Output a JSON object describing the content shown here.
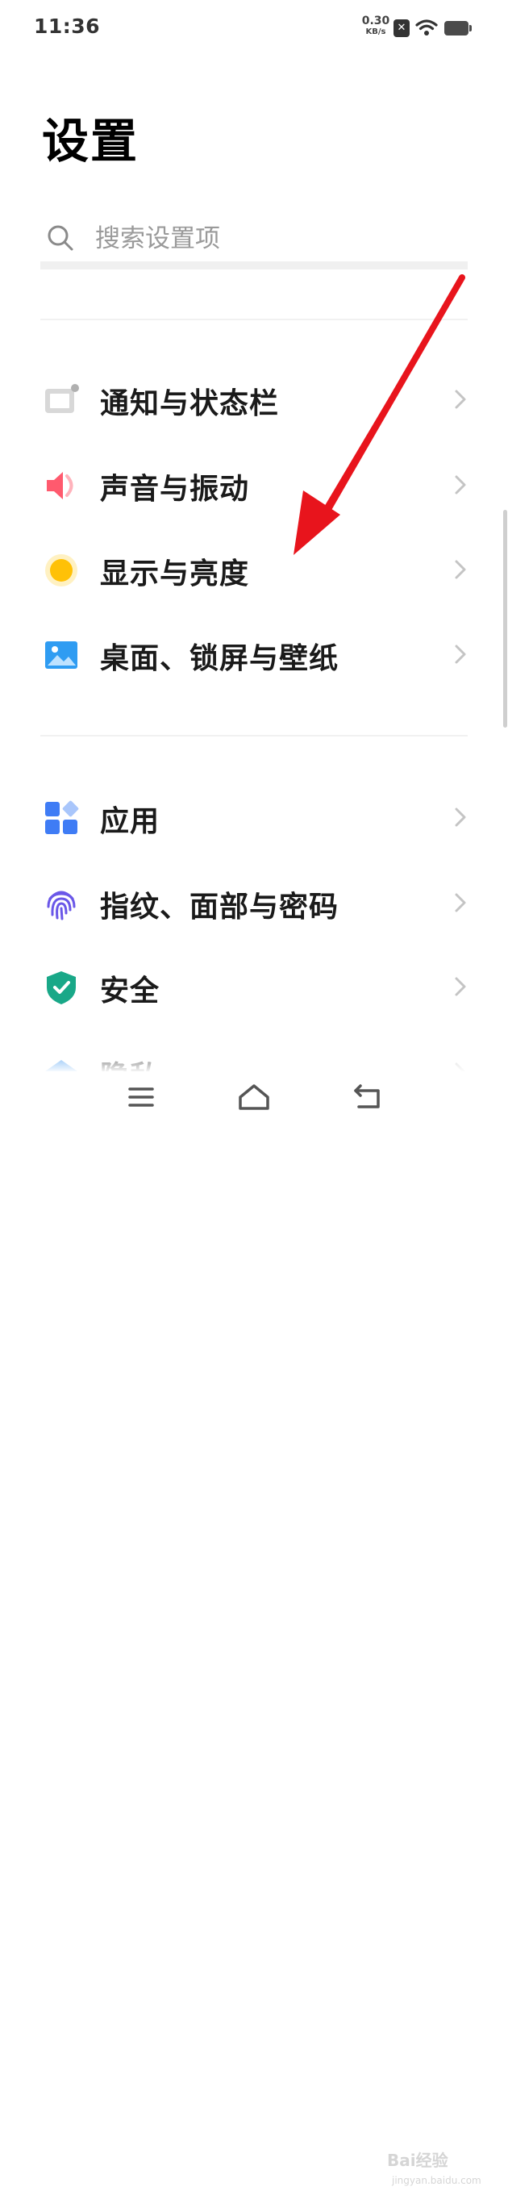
{
  "status_bar": {
    "time": "11:36",
    "net_speed_value": "0.30",
    "net_speed_unit": "KB/s",
    "sim_icon": "no-sim-icon",
    "wifi_icon": "wifi-icon",
    "battery_icon": "battery-icon"
  },
  "header": {
    "title": "设置"
  },
  "search": {
    "placeholder": "搜索设置项",
    "icon": "search-icon"
  },
  "settings": {
    "group1": [
      {
        "label": "通知与状态栏",
        "icon": "notification-icon",
        "color": "#9e9e9e"
      },
      {
        "label": "声音与振动",
        "icon": "speaker-icon",
        "color": "#ff5a6e"
      },
      {
        "label": "显示与亮度",
        "icon": "brightness-icon",
        "color": "#ffc107"
      },
      {
        "label": "桌面、锁屏与壁纸",
        "icon": "wallpaper-icon",
        "color": "#2f9cf2"
      }
    ],
    "group2": [
      {
        "label": "应用",
        "icon": "apps-icon",
        "color": "#3f7cf5"
      },
      {
        "label": "指纹、面部与密码",
        "icon": "fingerprint-icon",
        "color": "#6a57e8"
      },
      {
        "label": "安全",
        "icon": "shield-icon",
        "color": "#19a888"
      },
      {
        "label": "隐私",
        "icon": "privacy-icon",
        "color": "#2f8ff0"
      }
    ]
  },
  "nav": {
    "menu_icon": "menu-icon",
    "home_icon": "home-icon",
    "back_icon": "back-icon"
  },
  "watermark": {
    "line1": "Bai经验",
    "line2": "jingyan.baidu.com"
  },
  "annotation": {
    "arrow_color": "#e8141c"
  }
}
